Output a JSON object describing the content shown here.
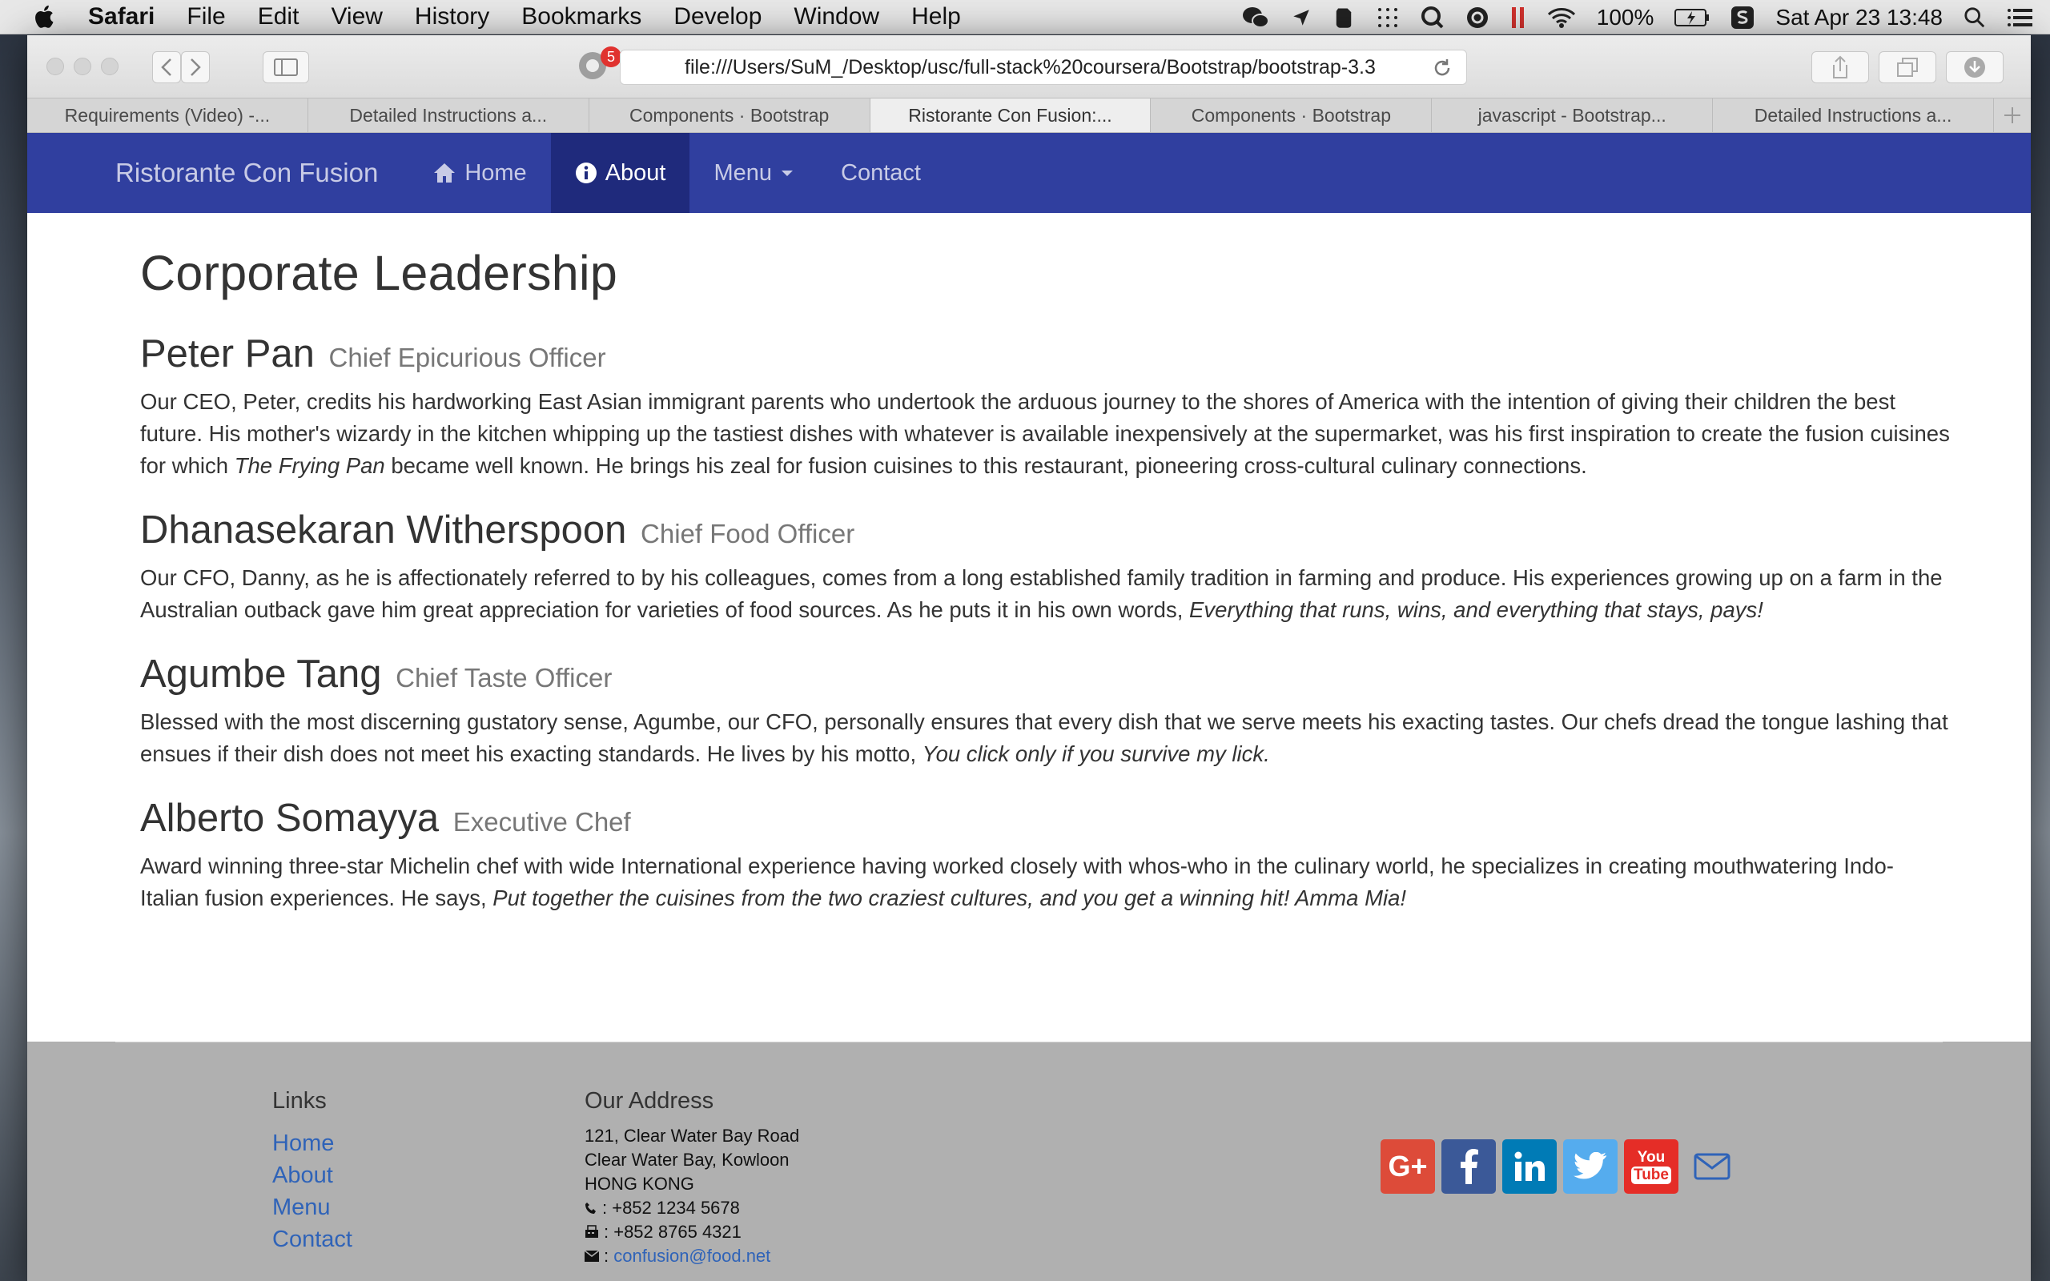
{
  "menubar": {
    "app": "Safari",
    "items": [
      "File",
      "Edit",
      "View",
      "History",
      "Bookmarks",
      "Develop",
      "Window",
      "Help"
    ],
    "battery": "100%",
    "datetime": "Sat Apr 23  13:48"
  },
  "browser": {
    "url": "file:///Users/SuM_/Desktop/usc/full-stack%20coursera/Bootstrap/bootstrap-3.3",
    "extension_badge": "5",
    "tabs": [
      "Requirements (Video) -...",
      "Detailed Instructions a...",
      "Components · Bootstrap",
      "Ristorante Con Fusion:...",
      "Components · Bootstrap",
      "javascript - Bootstrap...",
      "Detailed Instructions a..."
    ]
  },
  "navbar": {
    "brand": "Ristorante Con Fusion",
    "items": [
      {
        "label": "Home",
        "icon": "home-icon"
      },
      {
        "label": "About",
        "icon": "info-circle-icon"
      },
      {
        "label": "Menu",
        "icon": "caret-down-icon"
      },
      {
        "label": "Contact"
      }
    ],
    "active_color": "#1f2a7c",
    "bar_color": "#303f9f"
  },
  "main": {
    "title": "Corporate Leadership",
    "people": [
      {
        "name": "Peter Pan",
        "role": "Chief Epicurious Officer",
        "text": "Our CEO, Peter, credits his hardworking East Asian immigrant parents who undertook the arduous journey to the shores of America with the intention of giving their children the best future. His mother's wizardy in the kitchen whipping up the tastiest dishes with whatever is available inexpensively at the supermarket, was his first inspiration to create the fusion cuisines for which ",
        "em": "The Frying Pan",
        "text2": " became well known. He brings his zeal for fusion cuisines to this restaurant, pioneering cross-cultural culinary connections."
      },
      {
        "name": "Dhanasekaran Witherspoon",
        "role": "Chief Food Officer",
        "text": "Our CFO, Danny, as he is affectionately referred to by his colleagues, comes from a long established family tradition in farming and produce. His experiences growing up on a farm in the Australian outback gave him great appreciation for varieties of food sources. As he puts it in his own words, ",
        "em": "Everything that runs, wins, and everything that stays, pays!",
        "text2": ""
      },
      {
        "name": "Agumbe Tang",
        "role": "Chief Taste Officer",
        "text": "Blessed with the most discerning gustatory sense, Agumbe, our CFO, personally ensures that every dish that we serve meets his exacting tastes. Our chefs dread the tongue lashing that ensues if their dish does not meet his exacting standards. He lives by his motto, ",
        "em": "You click only if you survive my lick.",
        "text2": ""
      },
      {
        "name": "Alberto Somayya",
        "role": "Executive Chef",
        "text": "Award winning three-star Michelin chef with wide International experience having worked closely with whos-who in the culinary world, he specializes in creating mouthwatering Indo-Italian fusion experiences. He says, ",
        "em": "Put together the cuisines from the two craziest cultures, and you get a winning hit! Amma Mia!",
        "text2": ""
      }
    ]
  },
  "footer": {
    "links_title": "Links",
    "links": [
      "Home",
      "About",
      "Menu",
      "Contact"
    ],
    "address_title": "Our Address",
    "address_lines": [
      "121, Clear Water Bay Road",
      "Clear Water Bay, Kowloon",
      "HONG KONG"
    ],
    "phone": ": +852 1234 5678",
    "fax": ": +852 8765 4321",
    "email_prefix": ":",
    "email": "confusion@food.net",
    "social": [
      {
        "icon": "google-plus-icon",
        "color": "#dd4b39"
      },
      {
        "icon": "facebook-icon",
        "color": "#3b5998"
      },
      {
        "icon": "linkedin-icon",
        "color": "#007bb6"
      },
      {
        "icon": "twitter-icon",
        "color": "#55acee"
      },
      {
        "icon": "youtube-icon",
        "color": "#e52d27"
      },
      {
        "icon": "envelope-icon",
        "color": "#2f63b8"
      }
    ],
    "youtube_label_top": "You",
    "youtube_label_bottom": "Tube",
    "google_label": "G+"
  }
}
